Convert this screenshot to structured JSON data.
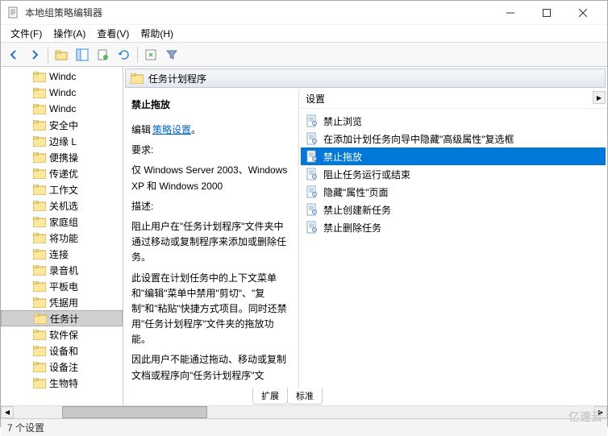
{
  "window": {
    "title": "本地组策略编辑器"
  },
  "menus": {
    "file": "文件(F)",
    "action": "操作(A)",
    "view": "查看(V)",
    "help": "帮助(H)"
  },
  "tree": {
    "items": [
      {
        "label": "Windc"
      },
      {
        "label": "Windc"
      },
      {
        "label": "Windc"
      },
      {
        "label": "安全中"
      },
      {
        "label": "边缘 L"
      },
      {
        "label": "便携操"
      },
      {
        "label": "传递优"
      },
      {
        "label": "工作文"
      },
      {
        "label": "关机选"
      },
      {
        "label": "家庭组"
      },
      {
        "label": "将功能"
      },
      {
        "label": "连接"
      },
      {
        "label": "录音机"
      },
      {
        "label": "平板电"
      },
      {
        "label": "凭据用"
      },
      {
        "label": "任务计",
        "selected": true
      },
      {
        "label": "软件保"
      },
      {
        "label": "设备和"
      },
      {
        "label": "设备注"
      },
      {
        "label": "生物特"
      }
    ]
  },
  "detail": {
    "header": "任务计划程序",
    "policy_name": "禁止拖放",
    "edit_prefix": "编辑",
    "edit_link": "策略设置",
    "req_label": "要求:",
    "req_text": "仅 Windows Server 2003、Windows XP 和 Windows 2000",
    "desc_label": "描述:",
    "desc_p1": "阻止用户在\"任务计划程序\"文件夹中通过移动或复制程序来添加或删除任务。",
    "desc_p2": "此设置在计划任务中的上下文菜单和\"编辑\"菜单中禁用\"剪切\"、\"复制\"和\"粘贴\"快捷方式项目。同时还禁用\"任务计划程序\"文件夹的拖放功能。",
    "desc_p3": "因此用户不能通过拖动、移动或复制文档或程序向\"任务计划程序\"文"
  },
  "settings": {
    "header": "设置",
    "items": [
      {
        "label": "禁止浏览"
      },
      {
        "label": "在添加计划任务向导中隐藏\"高级属性\"复选框"
      },
      {
        "label": "禁止拖放",
        "selected": true
      },
      {
        "label": "阻止任务运行或结束"
      },
      {
        "label": "隐藏\"属性\"页面"
      },
      {
        "label": "禁止创建新任务"
      },
      {
        "label": "禁止删除任务"
      }
    ]
  },
  "tabs": {
    "extended": "扩展",
    "standard": "标准"
  },
  "status": "7 个设置",
  "watermark": "亿速云"
}
